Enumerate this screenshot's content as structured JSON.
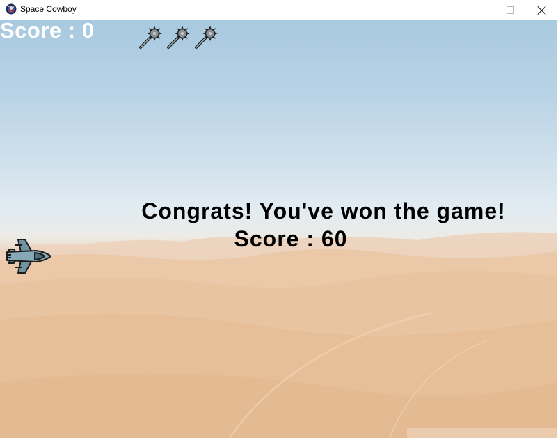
{
  "window": {
    "title": "Space Cowboy",
    "icon": "app-emblem-icon",
    "controls": [
      "minimize-icon",
      "maximize-icon",
      "close-icon"
    ]
  },
  "hud": {
    "score_text": "Score : 0",
    "lives_remaining": 3,
    "life_icon": "mace-icon"
  },
  "message": {
    "headline": "Congrats! You've won the game!",
    "final_score": "Score : 60"
  },
  "player": {
    "icon": "fighter-jet-icon"
  },
  "colors": {
    "hud_text": "#ffffff",
    "message_text": "#000000",
    "sky_top": "#a8c9df",
    "sand": "#eac4a1",
    "jet_body": "#7fa3b2"
  }
}
